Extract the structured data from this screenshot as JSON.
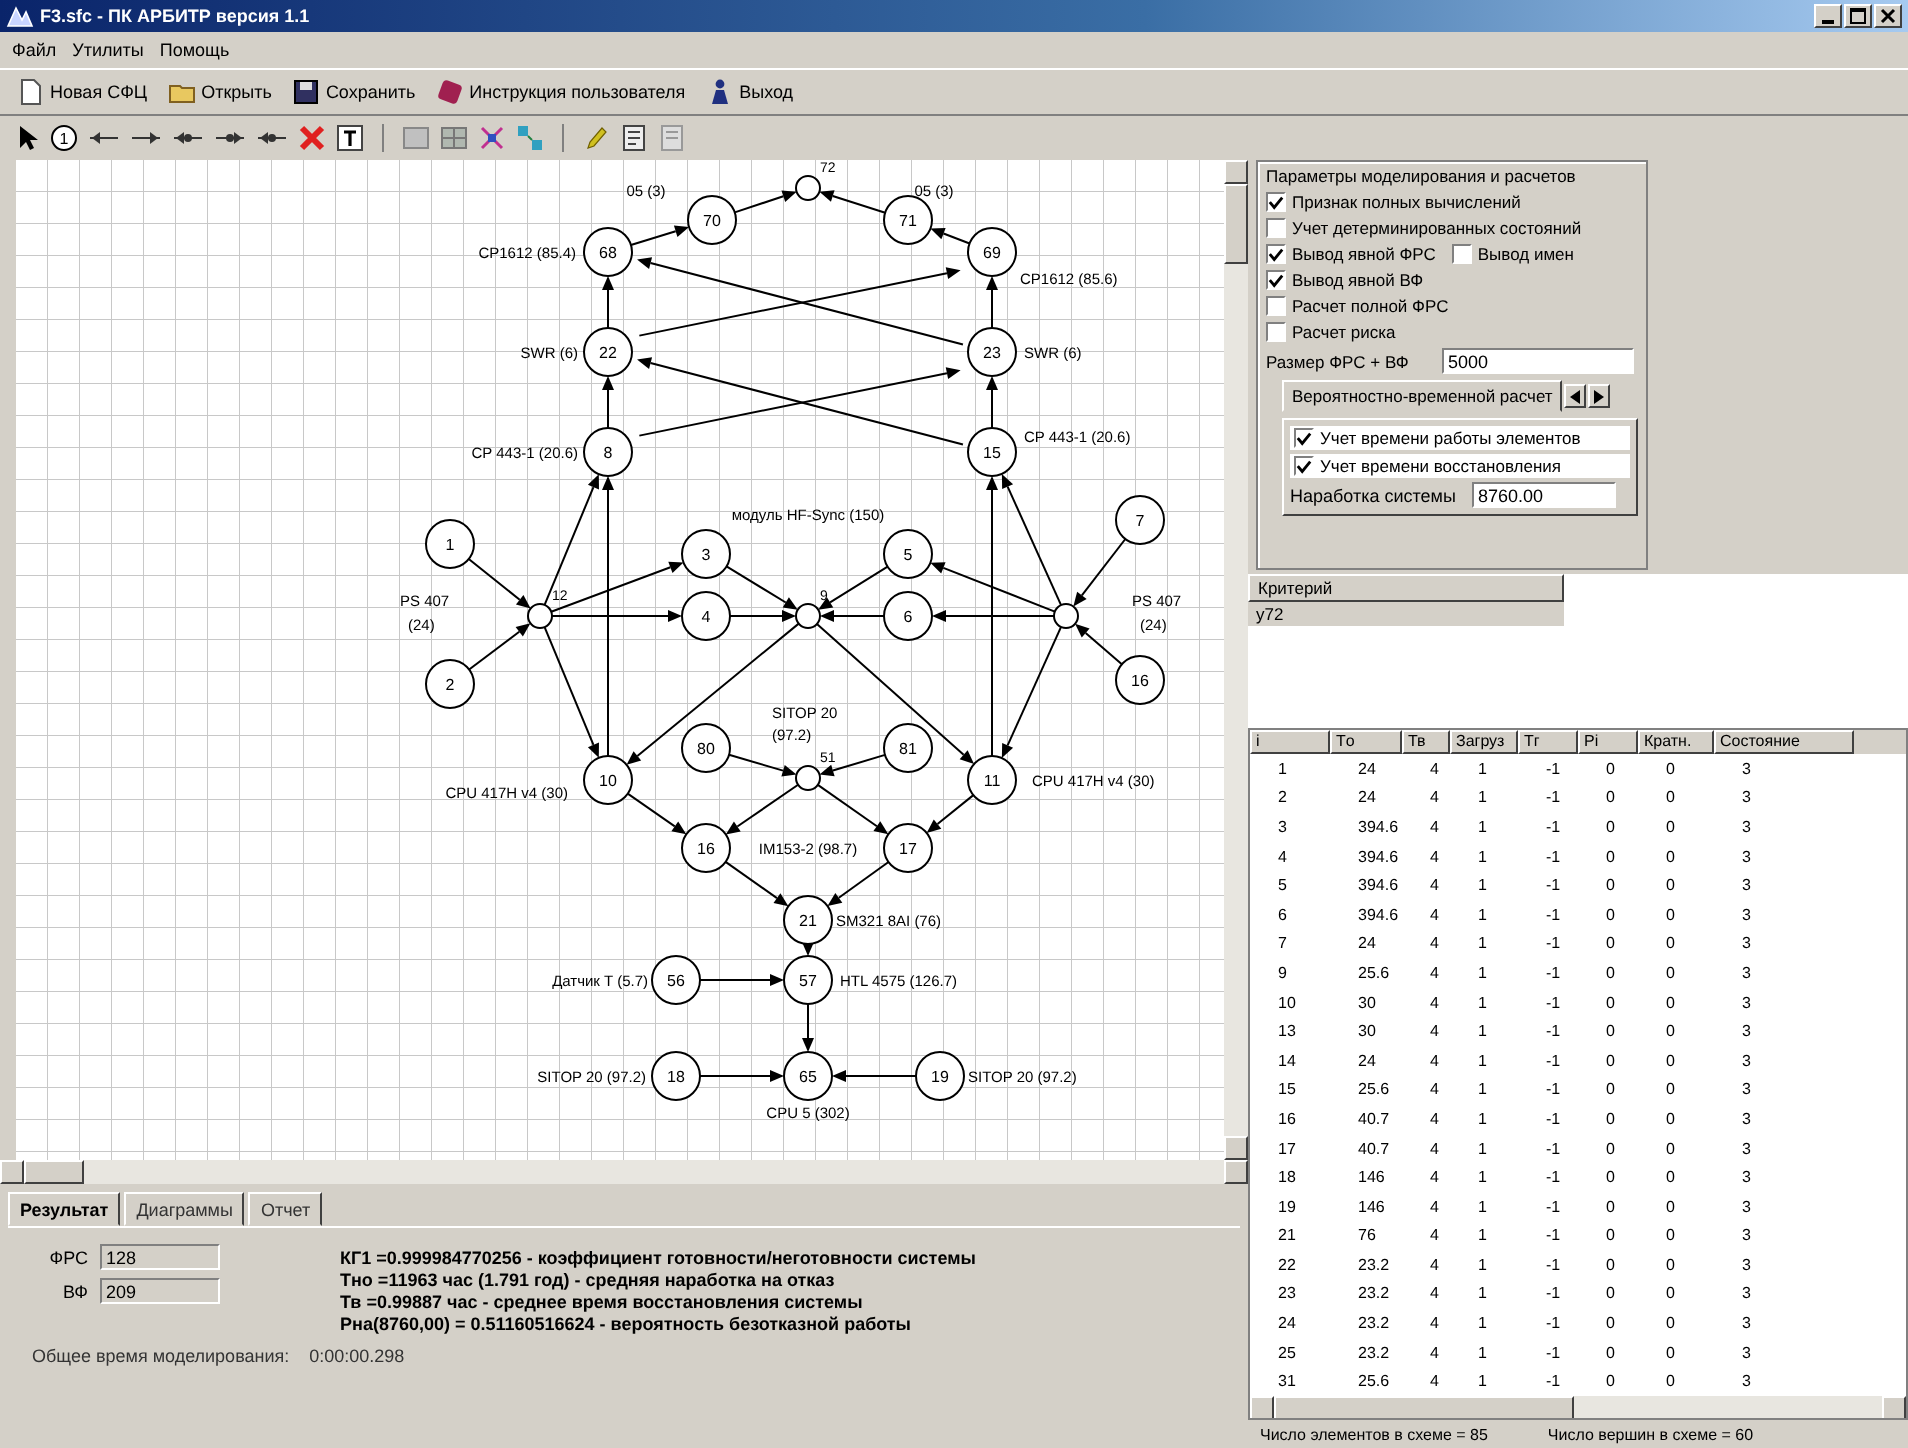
{
  "window": {
    "title": "F3.sfc - ПК АРБИТР версия 1.1"
  },
  "menu": [
    "Файл",
    "Утилиты",
    "Помощь"
  ],
  "toolbar": [
    "Новая СФЦ",
    "Открыть",
    "Сохранить",
    "Инструкция пользователя",
    "Выход"
  ],
  "tools": {
    "node_label": "1"
  },
  "graph": {
    "nodes": [
      {
        "label": "72",
        "kind": "junction"
      },
      {
        "label": "70",
        "kind": "node"
      },
      {
        "label": "71",
        "kind": "node"
      },
      {
        "label": "68",
        "kind": "node"
      },
      {
        "label": "69",
        "kind": "node"
      },
      {
        "label": "22",
        "kind": "node"
      },
      {
        "label": "23",
        "kind": "node"
      },
      {
        "label": "8",
        "kind": "node"
      },
      {
        "label": "15",
        "kind": "node"
      },
      {
        "label": "1",
        "kind": "node"
      },
      {
        "label": "2",
        "kind": "node"
      },
      {
        "label": "7",
        "kind": "node"
      },
      {
        "label": "16",
        "kind": "node"
      },
      {
        "label": "12",
        "kind": "junction"
      },
      {
        "kind": "junction"
      },
      {
        "label": "3",
        "kind": "node"
      },
      {
        "label": "5",
        "kind": "node"
      },
      {
        "label": "4",
        "kind": "node"
      },
      {
        "label": "6",
        "kind": "node"
      },
      {
        "label": "9",
        "kind": "junction"
      },
      {
        "label": "10",
        "kind": "node"
      },
      {
        "label": "11",
        "kind": "node"
      },
      {
        "label": "80",
        "kind": "node"
      },
      {
        "label": "81",
        "kind": "node"
      },
      {
        "label": "51",
        "kind": "junction"
      },
      {
        "label": "16",
        "kind": "node"
      },
      {
        "label": "17",
        "kind": "node"
      },
      {
        "label": "21",
        "kind": "node"
      },
      {
        "label": "56",
        "kind": "node"
      },
      {
        "label": "57",
        "kind": "node"
      },
      {
        "label": "18",
        "kind": "node"
      },
      {
        "label": "65",
        "kind": "node"
      },
      {
        "label": "19",
        "kind": "node"
      }
    ],
    "captions": [
      "05 (3)",
      "05 (3)",
      "CP1612 (85.4)",
      "CP1612 (85.6)",
      "SWR (6)",
      "SWR (6)",
      "CP 443-1 (20.6)",
      "CP 443-1 (20.6)",
      "модуль HF-Sync (150)",
      "PS 407",
      "(24)",
      "PS 407",
      "(24)",
      "SITOP 20",
      "(97.2)",
      "CPU 417H v4 (30)",
      "CPU 417H v4 (30)",
      "IM153-2 (98.7)",
      "SM321 8AI (76)",
      "Датчик T (5.7)",
      "HTL 4575 (126.7)",
      "SITOP 20 (97.2)",
      "SITOP 20 (97.2)",
      "CPU 5 (302)"
    ]
  },
  "bottom": {
    "tabs": [
      {
        "label": "Результат",
        "selected": true
      },
      {
        "label": "Диаграммы",
        "selected": false
      },
      {
        "label": "Отчет",
        "selected": false
      }
    ],
    "fields": [
      {
        "label": "ФРС",
        "value": "128"
      },
      {
        "label": "ВФ",
        "value": "209"
      }
    ],
    "results": [
      "КГ1 =0.999984770256 - коэффициент готовности/неготовности системы",
      "Тно =11963 час (1.791 год) - средняя наработка на отказ",
      "Тв =0.99887 час - среднее время восстановления системы",
      "Рна(8760,00) = 0.51160516624 - вероятность безотказной работы"
    ],
    "total_time": {
      "label": "Общее время моделирования:",
      "value": "0:00:00.298"
    }
  },
  "params": {
    "title": "Параметры моделирования и расчетов",
    "option_rows": [
      [
        {
          "label": "Признак полных вычислений",
          "checked": true
        }
      ],
      [
        {
          "label": "Учет детерминированных состояний",
          "checked": false
        }
      ],
      [
        {
          "label": "Вывод явной ФРС",
          "checked": true
        },
        {
          "label": "Вывод имен",
          "checked": false
        }
      ],
      [
        {
          "label": "Вывод явной ВФ",
          "checked": true
        }
      ],
      [
        {
          "label": "Расчет полной ФРС",
          "checked": false
        }
      ],
      [
        {
          "label": "Расчет риска",
          "checked": false
        }
      ]
    ],
    "size_label": "Размер ФРС + ВФ",
    "size_value": "5000",
    "prob_tab": "Вероятностно-временной расчет",
    "prob_options": [
      {
        "label": "Учет времени работы элементов",
        "checked": true
      },
      {
        "label": "Учет времени восстановления",
        "checked": true
      }
    ],
    "runtime_label": "Наработка системы",
    "runtime_value": "8760.00"
  },
  "criterion": {
    "header": "Критерий",
    "rows": [
      "y72"
    ]
  },
  "table": {
    "columns": [
      "i",
      "Тo",
      "Тв",
      "Загруз",
      "Тг",
      "Pi",
      "Кратн.",
      "Состояние"
    ],
    "rows": [
      [
        "1",
        "24",
        "4",
        "1",
        "-1",
        "0",
        "0",
        "3"
      ],
      [
        "2",
        "24",
        "4",
        "1",
        "-1",
        "0",
        "0",
        "3"
      ],
      [
        "3",
        "394.6",
        "4",
        "1",
        "-1",
        "0",
        "0",
        "3"
      ],
      [
        "4",
        "394.6",
        "4",
        "1",
        "-1",
        "0",
        "0",
        "3"
      ],
      [
        "5",
        "394.6",
        "4",
        "1",
        "-1",
        "0",
        "0",
        "3"
      ],
      [
        "6",
        "394.6",
        "4",
        "1",
        "-1",
        "0",
        "0",
        "3"
      ],
      [
        "7",
        "24",
        "4",
        "1",
        "-1",
        "0",
        "0",
        "3"
      ],
      [
        "9",
        "25.6",
        "4",
        "1",
        "-1",
        "0",
        "0",
        "3"
      ],
      [
        "10",
        "30",
        "4",
        "1",
        "-1",
        "0",
        "0",
        "3"
      ],
      [
        "13",
        "30",
        "4",
        "1",
        "-1",
        "0",
        "0",
        "3"
      ],
      [
        "14",
        "24",
        "4",
        "1",
        "-1",
        "0",
        "0",
        "3"
      ],
      [
        "15",
        "25.6",
        "4",
        "1",
        "-1",
        "0",
        "0",
        "3"
      ],
      [
        "16",
        "40.7",
        "4",
        "1",
        "-1",
        "0",
        "0",
        "3"
      ],
      [
        "17",
        "40.7",
        "4",
        "1",
        "-1",
        "0",
        "0",
        "3"
      ],
      [
        "18",
        "146",
        "4",
        "1",
        "-1",
        "0",
        "0",
        "3"
      ],
      [
        "19",
        "146",
        "4",
        "1",
        "-1",
        "0",
        "0",
        "3"
      ],
      [
        "21",
        "76",
        "4",
        "1",
        "-1",
        "0",
        "0",
        "3"
      ],
      [
        "22",
        "23.2",
        "4",
        "1",
        "-1",
        "0",
        "0",
        "3"
      ],
      [
        "23",
        "23.2",
        "4",
        "1",
        "-1",
        "0",
        "0",
        "3"
      ],
      [
        "24",
        "23.2",
        "4",
        "1",
        "-1",
        "0",
        "0",
        "3"
      ],
      [
        "25",
        "23.2",
        "4",
        "1",
        "-1",
        "0",
        "0",
        "3"
      ],
      [
        "31",
        "25.6",
        "4",
        "1",
        "-1",
        "0",
        "0",
        "3"
      ]
    ]
  },
  "status": [
    "Число элементов в схеме = 85",
    "Число вершин в схеме = 60"
  ]
}
